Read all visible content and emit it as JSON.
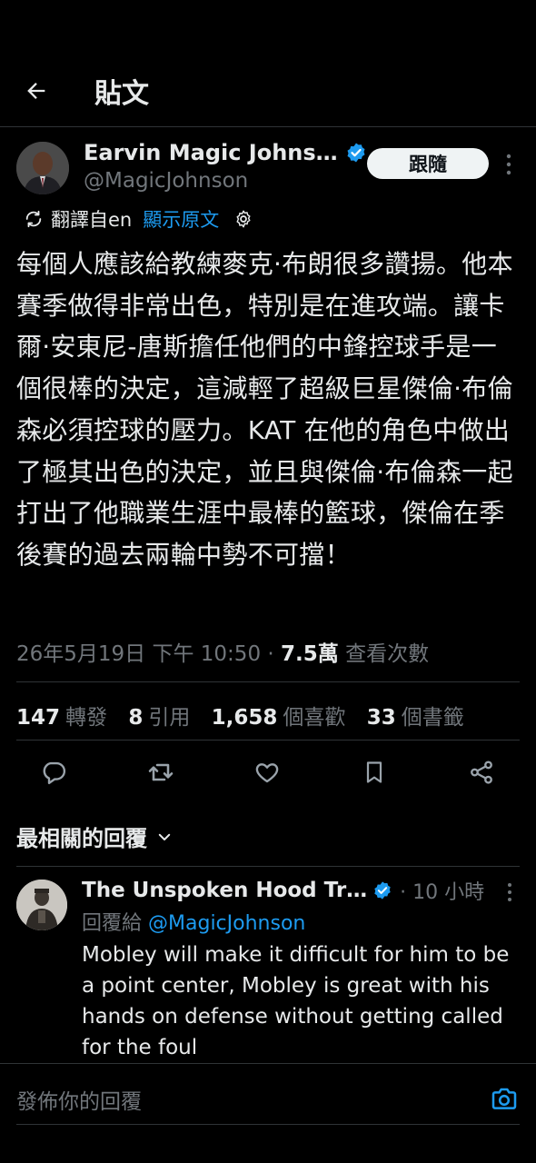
{
  "header": {
    "title": "貼文"
  },
  "tweet": {
    "author_name": "Earvin Magic Johns…",
    "author_handle": "@MagicJohnson",
    "follow_label": "跟隨",
    "translated_label": "翻譯自en",
    "show_original_label": "顯示原文",
    "text": "每個人應該給教練麥克·布朗很多讚揚。他本賽季做得非常出色，特別是在進攻端。讓卡爾·安東尼-唐斯擔任他們的中鋒控球手是一個很棒的決定，這減輕了超級巨星傑倫·布倫森必須控球的壓力。KAT 在他的角色中做出了極其出色的決定，並且與傑倫·布倫森一起打出了他職業生涯中最棒的籃球，傑倫在季後賽的過去兩輪中勢不可擋！",
    "timestamp": "26年5月19日 下午 10:50",
    "separator": " · ",
    "views_count": "7.5萬",
    "views_label": "查看次數"
  },
  "stats": {
    "reposts_count": "147",
    "reposts_label": "轉發",
    "quotes_count": "8",
    "quotes_label": "引用",
    "likes_count": "1,658",
    "likes_label": "個喜歡",
    "bookmarks_count": "33",
    "bookmarks_label": "個書籤"
  },
  "actions": [
    "reply-icon",
    "repost-icon",
    "like-icon",
    "bookmark-icon",
    "share-icon"
  ],
  "replies": {
    "sort_label": "最相關的回覆",
    "items": [
      {
        "name": "The Unspoken Hood Tr…",
        "time": "· 10 小時",
        "reply_to_prefix": "回覆給",
        "reply_to_handle": "@MagicJohnson",
        "text": "Mobley will make it difficult for him to be a point center, Mobley is great with his hands on defense without getting called for the foul"
      }
    ]
  },
  "composer": {
    "placeholder": "發佈你的回覆"
  },
  "colors": {
    "accent": "#1d9bf0",
    "background": "#000000",
    "text": "#e7e9ea",
    "muted": "#71767b"
  }
}
